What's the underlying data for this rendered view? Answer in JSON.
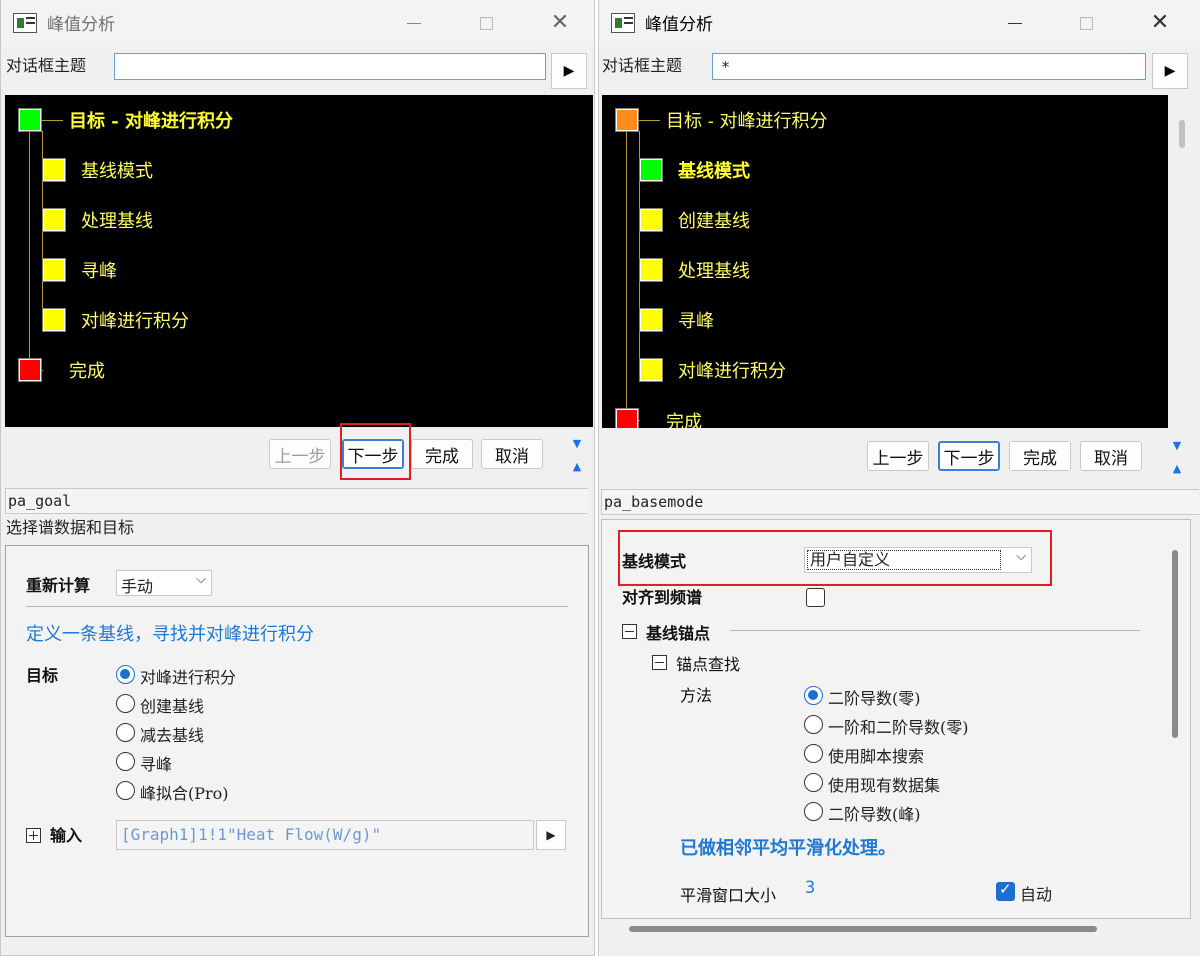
{
  "window1": {
    "title": "峰值分析",
    "theme_label": "对话框主题",
    "theme_value": "",
    "run_arrow": "▶",
    "tree": [
      {
        "label": "目标 - 对峰进行积分",
        "state": "green"
      },
      {
        "label": "基线模式",
        "state": "yellow"
      },
      {
        "label": "处理基线",
        "state": "yellow"
      },
      {
        "label": "寻峰",
        "state": "yellow"
      },
      {
        "label": "对峰进行积分",
        "state": "yellow"
      },
      {
        "label": "完成",
        "state": "red"
      }
    ],
    "buttons": {
      "prev": "上一步",
      "next": "下一步",
      "finish": "完成",
      "cancel": "取消"
    },
    "page_name": "pa_goal",
    "page_desc": "选择谱数据和目标",
    "recalc_label": "重新计算",
    "recalc_value": "手动",
    "info_text": "定义一条基线，寻找并对峰进行积分",
    "goal_label": "目标",
    "goal_options": [
      "对峰进行积分",
      "创建基线",
      "减去基线",
      "寻峰",
      "峰拟合(Pro)"
    ],
    "goal_selected": 0,
    "input_label": "输入",
    "input_value": "[Graph1]1!1\"Heat Flow(W/g)\""
  },
  "window2": {
    "title": "峰值分析",
    "theme_label": "对话框主题",
    "theme_value": "*",
    "run_arrow": "▶",
    "tree": [
      {
        "label": "目标 - 对峰进行积分",
        "state": "orange"
      },
      {
        "label": "基线模式",
        "state": "green"
      },
      {
        "label": "创建基线",
        "state": "yellow"
      },
      {
        "label": "处理基线",
        "state": "yellow"
      },
      {
        "label": "寻峰",
        "state": "yellow"
      },
      {
        "label": "对峰进行积分",
        "state": "yellow"
      },
      {
        "label": "完成",
        "state": "red"
      }
    ],
    "buttons": {
      "prev": "上一步",
      "next": "下一步",
      "finish": "完成",
      "cancel": "取消"
    },
    "page_name": "pa_basemode",
    "baseline_mode_label": "基线模式",
    "baseline_mode_value": "用户自定义",
    "snap_label": "对齐到频谱",
    "anchor_group": "基线锚点",
    "anchor_find_group": "锚点查找",
    "method_label": "方法",
    "method_options": [
      "二阶导数(零)",
      "一阶和二阶导数(零)",
      "使用脚本搜索",
      "使用现有数据集",
      "二阶导数(峰)"
    ],
    "method_selected": 0,
    "smooth_info": "已做相邻平均平滑化处理。",
    "smooth_window_label": "平滑窗口大小",
    "smooth_window_value": "3",
    "auto_label": "自动"
  }
}
